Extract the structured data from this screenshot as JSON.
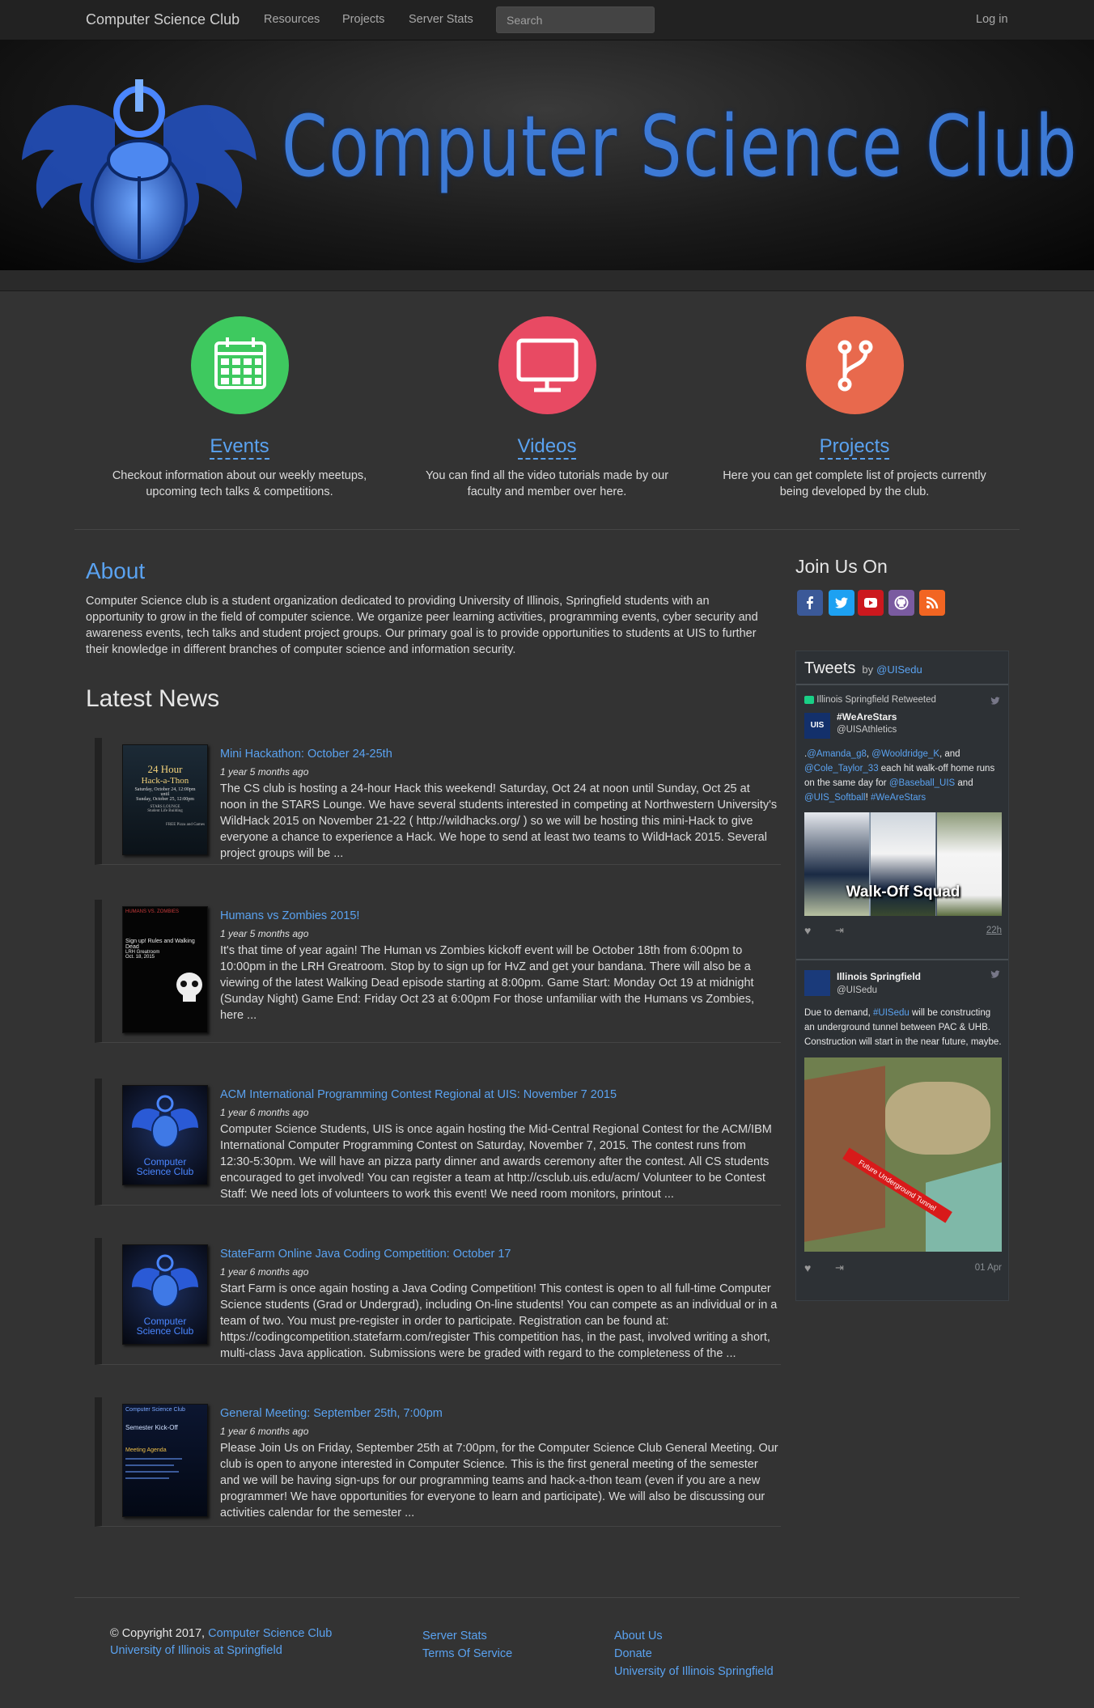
{
  "navbar": {
    "brand": "Computer Science Club",
    "links": [
      "Resources",
      "Projects",
      "Server Stats"
    ],
    "search_placeholder": "Search",
    "login": "Log in"
  },
  "hero": {
    "title": "Computer Science Club"
  },
  "features": [
    {
      "title": "Events",
      "icon": "calendar-icon",
      "color": "#3ec95f",
      "text": "Checkout information about our weekly meetups, upcoming tech talks & competitions."
    },
    {
      "title": "Videos",
      "icon": "monitor-icon",
      "color": "#e84a63",
      "text": "You can find all the video tutorials made by our faculty and member over here."
    },
    {
      "title": "Projects",
      "icon": "code-fork-icon",
      "color": "#e8694d",
      "text": "Here you can get complete list of projects currently being developed by the club."
    }
  ],
  "about": {
    "title": "About",
    "text": "Computer Science club is a student organization dedicated to providing University of Illinois, Springfield students with an opportunity to grow in the field of computer science. We organize peer learning activities, programming events, cyber security and awareness events, tech talks and student project groups. Our primary goal is to provide opportunities to students at UIS to further their knowledge in different branches of computer science and information security."
  },
  "news": {
    "title": "Latest News",
    "items": [
      {
        "title": "Mini Hackathon: October 24-25th",
        "meta": "1 year 5 months ago",
        "text": "The CS club is hosting a 24-hour Hack this weekend! Saturday, Oct 24 at noon until Sunday, Oct 25 at noon in the STARS Lounge. We have several students interested in competing at Northwestern University's WildHack 2015 on November 21-22 ( http://wildhacks.org/ ) so we will be hosting this mini-Hack to give everyone a chance to experience a Hack. We hope to send at least two teams to WildHack 2015. Several project groups will be ..."
      },
      {
        "title": "Humans vs Zombies 2015!",
        "meta": "1 year 5 months ago",
        "text": "It's that time of year again! The Human vs Zombies kickoff event will be October 18th from 6:00pm to 10:00pm in the LRH Greatroom. Stop by to sign up for HvZ and get your bandana. There will also be a viewing of the latest Walking Dead episode starting at 8:00pm. Game Start: Monday Oct 19 at midnight (Sunday Night) Game End: Friday Oct 23 at 6:00pm For those unfamiliar with the Humans vs Zombies, here ..."
      },
      {
        "title": "ACM International Programming Contest Regional at UIS: November 7 2015",
        "meta": "1 year 6 months ago",
        "text": "Computer Science Students, UIS is once again hosting the Mid-Central Regional Contest for the ACM/IBM International Computer Programming Contest on Saturday, November 7, 2015. The contest runs from 12:30-5:30pm. We will have an pizza party dinner and awards ceremony after the contest. All CS students encouraged to get involved! You can register a team at http://csclub.uis.edu/acm/ Volunteer to be Contest Staff: We need lots of volunteers to work this event! We need room monitors, printout ..."
      },
      {
        "title": "StateFarm Online Java Coding Competition: October 17",
        "meta": "1 year 6 months ago",
        "text": "Start Farm is once again hosting a Java Coding Competition! This contest is open to all full-time Computer Science students (Grad or Undergrad), including On-line students! You can compete as an individual or in a team of two. You must pre-register in order to participate. Registration can be found at: https://codingcompetition.statefarm.com/register This competition has, in the past, involved writing a short, multi-class Java application. Submissions were be graded with regard to the completeness of the ..."
      },
      {
        "title": "General Meeting: September 25th, 7:00pm",
        "meta": "1 year 6 months ago",
        "text": "Please Join Us on Friday, September 25th at 7:00pm, for the Computer Science Club General Meeting. Our club is open to anyone interested in Computer Science. This is the first general meeting of the semester and we will be having sign-ups for our programming teams and hack-a-thon team (even if you are a new programmer! We have opportunities for everyone to learn and participate). We will also be discussing our activities calendar for the semester ..."
      }
    ],
    "thumbs": {
      "hackathon": {
        "l1": "24 Hour",
        "l2": "Hack-a-Thon",
        "l3": "Saturday, October 24, 12:00pm",
        "l4": "until",
        "l5": "Sunday, October 25, 12:00pm",
        "l6": "STARS LOUNGE",
        "l7": "Student Life Building",
        "l8": "FREE Pizza and Games"
      },
      "zombies": {
        "l1": "HUMANS VS. ZOMBIES",
        "l2": "Sign up! Rules and Walking Dead",
        "l3": "LRH Greatroom",
        "l4": "Oct. 18, 2015"
      },
      "logo": {
        "l1": "Computer",
        "l2": "Science Club"
      },
      "meeting": {
        "l1": "Computer Science Club",
        "l2": "Semester Kick-Off",
        "l3": "Meeting Agenda"
      }
    }
  },
  "sidebar": {
    "join_title": "Join Us On",
    "socials": [
      {
        "name": "facebook",
        "color": "#3b5998"
      },
      {
        "name": "twitter",
        "color": "#1da1f2"
      },
      {
        "name": "youtube",
        "color": "#cc181e"
      },
      {
        "name": "github",
        "color": "#7a5ba0"
      },
      {
        "name": "rss",
        "color": "#f26522"
      }
    ],
    "tweets": {
      "title": "Tweets",
      "by": "by",
      "handle": "@UISedu",
      "t1": {
        "retweeted": "Illinois Springfield Retweeted",
        "name": "#WeAreStars",
        "handle": "@UISAthletics",
        "text_pre": ".",
        "m1": "@Amanda_g8",
        "sep1": ", ",
        "m2": "@Wooldridge_K",
        "sep2": ", and",
        "m3": "@Cole_Taylor_33",
        "mid": " each hit walk-off home runs on the same day for ",
        "m4": "@Baseball_UIS",
        "and": " and ",
        "m5": "@UIS_Softball",
        "excl": "! ",
        "tag": "#WeAreStars",
        "image_caption": "Walk-Off Squad",
        "time": "22h"
      },
      "t2": {
        "name": "Illinois Springfield",
        "handle": "@UISedu",
        "text_pre": "Due to demand, ",
        "mention": "#UISedu",
        "text_post": " will be constructing an underground tunnel between PAC & UHB. Construction will start in the near future, maybe.",
        "image_caption": "Future Underground Tunnel",
        "time": "01 Apr"
      }
    }
  },
  "footer": {
    "copyright": "© Copyright 2017,",
    "club": "Computer Science Club",
    "university": "University of Illinois at Springfield",
    "col2": [
      "Server Stats",
      "Terms Of Service"
    ],
    "col3": [
      "About Us",
      "Donate",
      "University of Illinois Springfield"
    ]
  }
}
